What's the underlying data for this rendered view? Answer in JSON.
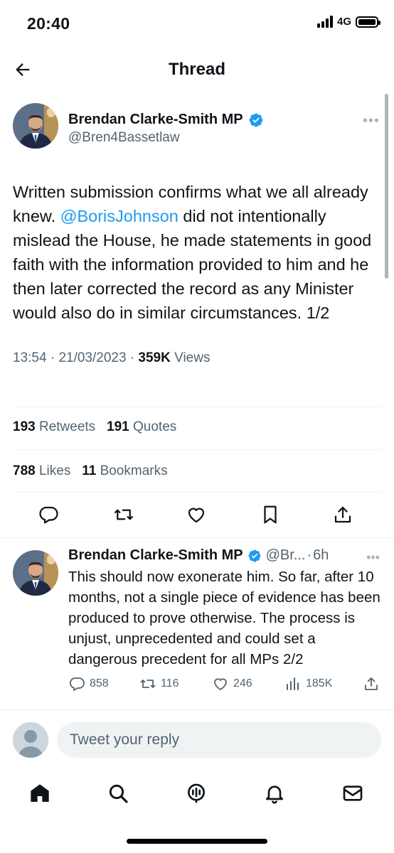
{
  "status_bar": {
    "time": "20:40",
    "network": "4G"
  },
  "header": {
    "title": "Thread"
  },
  "tweet": {
    "author_name": "Brendan Clarke-Smith MP",
    "author_handle": "@Bren4Bassetlaw",
    "text_1": "Written submission confirms what we all already knew. ",
    "mention": "@BorisJohnson",
    "text_2": " did not intentionally mislead the House, he made statements in good faith with the information provided to him and he then later corrected the record as any Minister would also do in similar circumstances. 1/2",
    "time": "13:54",
    "date": "21/03/2023",
    "views_count": "359K",
    "views_label": "Views",
    "retweets_count": "193",
    "retweets_label": "Retweets",
    "quotes_count": "191",
    "quotes_label": "Quotes",
    "likes_count": "788",
    "likes_label": "Likes",
    "bookmarks_count": "11",
    "bookmarks_label": "Bookmarks"
  },
  "reply": {
    "author_name": "Brendan Clarke-Smith MP",
    "author_handle": "@Br...",
    "age": "6h",
    "text": "This should now exonerate him. So far, after 10 months, not a single piece of evidence has been produced to prove otherwise. The process is unjust, unprecedented and could set a dangerous precedent for all MPs 2/2",
    "replies": "858",
    "retweets": "116",
    "likes": "246",
    "views": "185K"
  },
  "compose": {
    "placeholder": "Tweet your reply"
  },
  "icons": {
    "back": "arrow-left-icon",
    "verified": "verified-badge-icon",
    "reply": "comment-icon",
    "retweet": "retweet-icon",
    "like": "heart-icon",
    "bookmark": "bookmark-icon",
    "share": "share-icon",
    "views": "bar-chart-icon",
    "home": "home-icon",
    "search": "search-icon",
    "spaces": "spaces-icon",
    "notifications": "bell-icon",
    "messages": "mail-icon"
  },
  "colors": {
    "accent": "#1d9bf0",
    "text": "#0f1419",
    "secondary": "#536471"
  }
}
